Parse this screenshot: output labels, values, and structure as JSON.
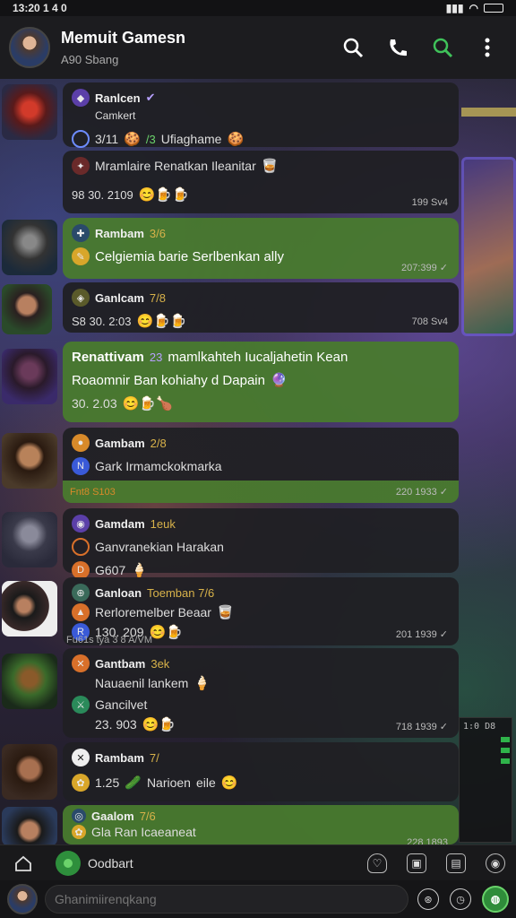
{
  "status_bar": {
    "time": "13:20 1 4 0"
  },
  "header": {
    "title": "Memuit Gamesn",
    "subtitle": "A90 Sbang"
  },
  "chats": [
    {
      "name": "Ranlcen",
      "verified": "✔",
      "line2": "Camkert",
      "line3": "3/11",
      "line3_tag": "/3",
      "line3_msg": "Ufiaghame",
      "time": "",
      "green": false
    },
    {
      "name": "",
      "line1_msg": "Mramlaire Renatkan Ileanitar",
      "line2_time": "98 30. 2109",
      "time": "199 Sv4",
      "green": false
    },
    {
      "name": "Rambam",
      "tag": "3/6",
      "line2": "Celgiemia barie Serlbenkan ally",
      "time": "207:399",
      "green": true
    },
    {
      "name": "Ganlcam",
      "tag": "7/8",
      "line2_time": "S8 30. 2:03",
      "time": "708 Sv4",
      "green": false
    },
    {
      "line1": "Renattivam",
      "line1_tag": "23",
      "line1_rest": "mamlkahteh Iucaljahetin Kean",
      "line2": "Roaomnir Ban kohiahy d Dapain",
      "line3": "30. 2.03",
      "time": "",
      "green": true
    },
    {
      "name": "Gambam",
      "tag": "2/8",
      "line2": "Gark Irmamckokmarka",
      "footer_left": "Fnt8 S103",
      "time": "220 1933",
      "green": false
    },
    {
      "name": "Gamdam",
      "tag": "1euk",
      "line2": "Ganvranekian Harakan",
      "line3": "G607",
      "time": "",
      "green": false
    },
    {
      "name": "Ganloan",
      "tag": "Toemban 7/6",
      "line2": "Rerloremelber Beaar",
      "line3": "130. 209",
      "footer_left": "Fu61s tya 3 8 A/VM",
      "time": "201 1939",
      "green": false
    },
    {
      "name": "Gantbam",
      "tag": "3ek",
      "line2": "Nauaenil lankem",
      "line3": "Gancilvet",
      "line4": "23. 903",
      "time": "718 1939",
      "green": false
    },
    {
      "name": "Rambam",
      "tag": "7/",
      "line2_a": "1.25",
      "line2_b": "Narioen",
      "line2_c": "eile",
      "time": "",
      "green": false
    },
    {
      "name": "Gaalom",
      "tag": "7/6",
      "line2": "Gla Ran Icaeaneat",
      "time": "228 1893",
      "green": true
    }
  ],
  "composer": {
    "label": "Oodbart"
  },
  "input": {
    "placeholder": "Ghanimiirenqkang"
  },
  "bg_stats": {
    "label": "1:0 D8"
  },
  "colors": {
    "accent_green": "#497a2e",
    "bubble_dark": "#202024",
    "header": "#1c1c1f"
  }
}
